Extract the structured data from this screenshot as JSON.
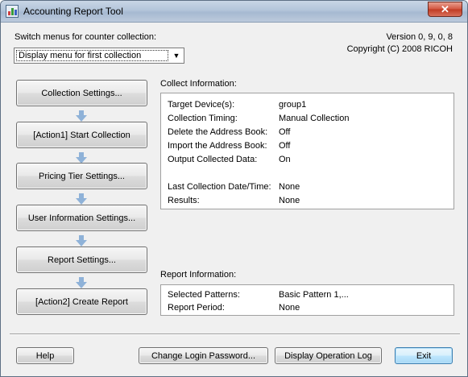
{
  "window": {
    "title": "Accounting Report Tool",
    "close_glyph": "✕"
  },
  "switch_label": "Switch menus for counter collection:",
  "menu_select": {
    "value": "Display menu for first collection",
    "arrow": "▼"
  },
  "version_text": "Version 0, 9, 0, 8",
  "copyright_text": "Copyright (C) 2008 RICOH",
  "steps": [
    "Collection Settings...",
    "[Action1] Start Collection",
    "Pricing Tier Settings...",
    "User Information Settings...",
    "Report Settings...",
    "[Action2] Create Report"
  ],
  "collect_info": {
    "heading": "Collect Information:",
    "rows": [
      {
        "key": "Target Device(s):",
        "value": "group1"
      },
      {
        "key": "Collection Timing:",
        "value": "Manual Collection"
      },
      {
        "key": "Delete the Address Book:",
        "value": "Off"
      },
      {
        "key": "Import the Address Book:",
        "value": "Off"
      },
      {
        "key": "Output Collected Data:",
        "value": "On"
      },
      {
        "key": "Last Collection Date/Time:",
        "value": "None"
      },
      {
        "key": "Results:",
        "value": "None"
      }
    ]
  },
  "report_info": {
    "heading": "Report Information:",
    "rows": [
      {
        "key": "Selected Patterns:",
        "value": "Basic Pattern 1,..."
      },
      {
        "key": "Report Period:",
        "value": "None"
      }
    ]
  },
  "footer": {
    "help": "Help",
    "change_password": "Change Login Password...",
    "display_log": "Display Operation Log",
    "exit": "Exit"
  },
  "colors": {
    "titlebar": "#b3c5da",
    "close_button": "#c03a22",
    "step_arrow": "#8fb2d8",
    "dialog_bg": "#f0f0f0"
  },
  "icons": [
    "app-icon",
    "close-icon",
    "dropdown-arrow-icon",
    "down-arrow-icon"
  ]
}
